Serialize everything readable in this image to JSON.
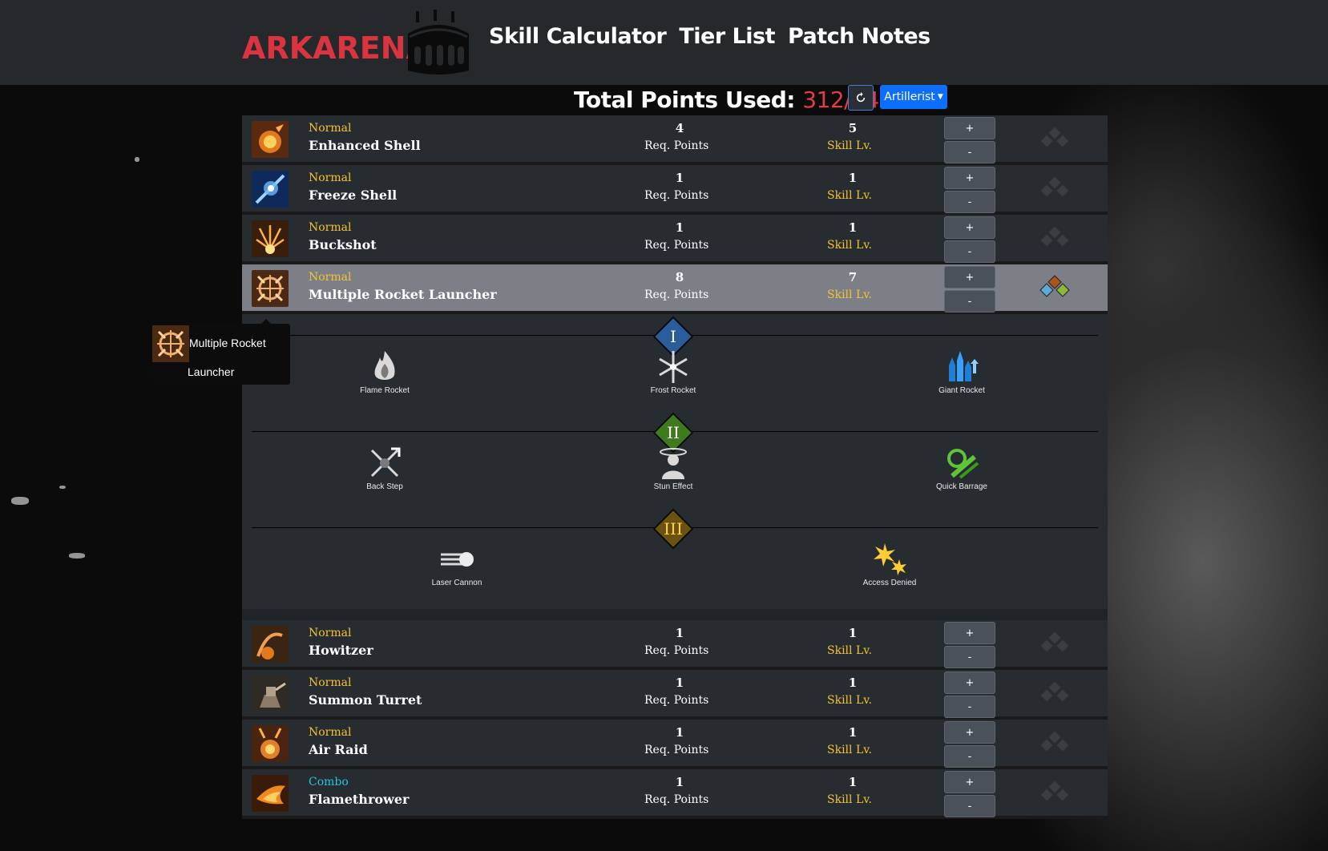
{
  "header": {
    "brand": "ARKARENA",
    "nav": [
      "Skill Calculator",
      "Tier List",
      "Patch Notes"
    ]
  },
  "points": {
    "label": "Total Points Used:",
    "value": "312/340",
    "reset_icon": "reset-icon",
    "class_selector": "Artillerist"
  },
  "labels": {
    "req_points": "Req. Points",
    "skill_lv": "Skill Lv.",
    "plus": "+",
    "minus": "-"
  },
  "skills_top": [
    {
      "type": "Normal",
      "name": "Enhanced Shell",
      "req": "4",
      "lv": "5",
      "icon": "explosion-icon",
      "tripods_active": false
    },
    {
      "type": "Normal",
      "name": "Freeze Shell",
      "req": "1",
      "lv": "1",
      "icon": "ice-shell-icon",
      "tripods_active": false
    },
    {
      "type": "Normal",
      "name": "Buckshot",
      "req": "1",
      "lv": "1",
      "icon": "buckshot-icon",
      "tripods_active": false
    },
    {
      "type": "Normal",
      "name": "Multiple Rocket Launcher",
      "req": "8",
      "lv": "7",
      "icon": "rocket-launcher-icon",
      "tripods_active": true
    }
  ],
  "tripods": {
    "tier1": {
      "numeral": "I",
      "color": "#2a5d9a",
      "items": [
        "Flame Rocket",
        "Frost Rocket",
        "Giant Rocket"
      ]
    },
    "tier2": {
      "numeral": "II",
      "color": "#3f7a1e",
      "items": [
        "Back Step",
        "Stun Effect",
        "Quick Barrage"
      ]
    },
    "tier3": {
      "numeral": "III",
      "color": "#6b5210",
      "items": [
        "Laser Cannon",
        "Access Denied"
      ]
    }
  },
  "skills_bottom": [
    {
      "type": "Normal",
      "name": "Howitzer",
      "req": "1",
      "lv": "1",
      "icon": "howitzer-icon"
    },
    {
      "type": "Normal",
      "name": "Summon Turret",
      "req": "1",
      "lv": "1",
      "icon": "turret-icon"
    },
    {
      "type": "Normal",
      "name": "Air Raid",
      "req": "1",
      "lv": "1",
      "icon": "air-raid-icon"
    },
    {
      "type": "Combo",
      "name": "Flamethrower",
      "req": "1",
      "lv": "1",
      "icon": "flamethrower-icon"
    }
  ],
  "tooltip": {
    "line1": "Multiple Rocket",
    "line2": "Launcher"
  }
}
